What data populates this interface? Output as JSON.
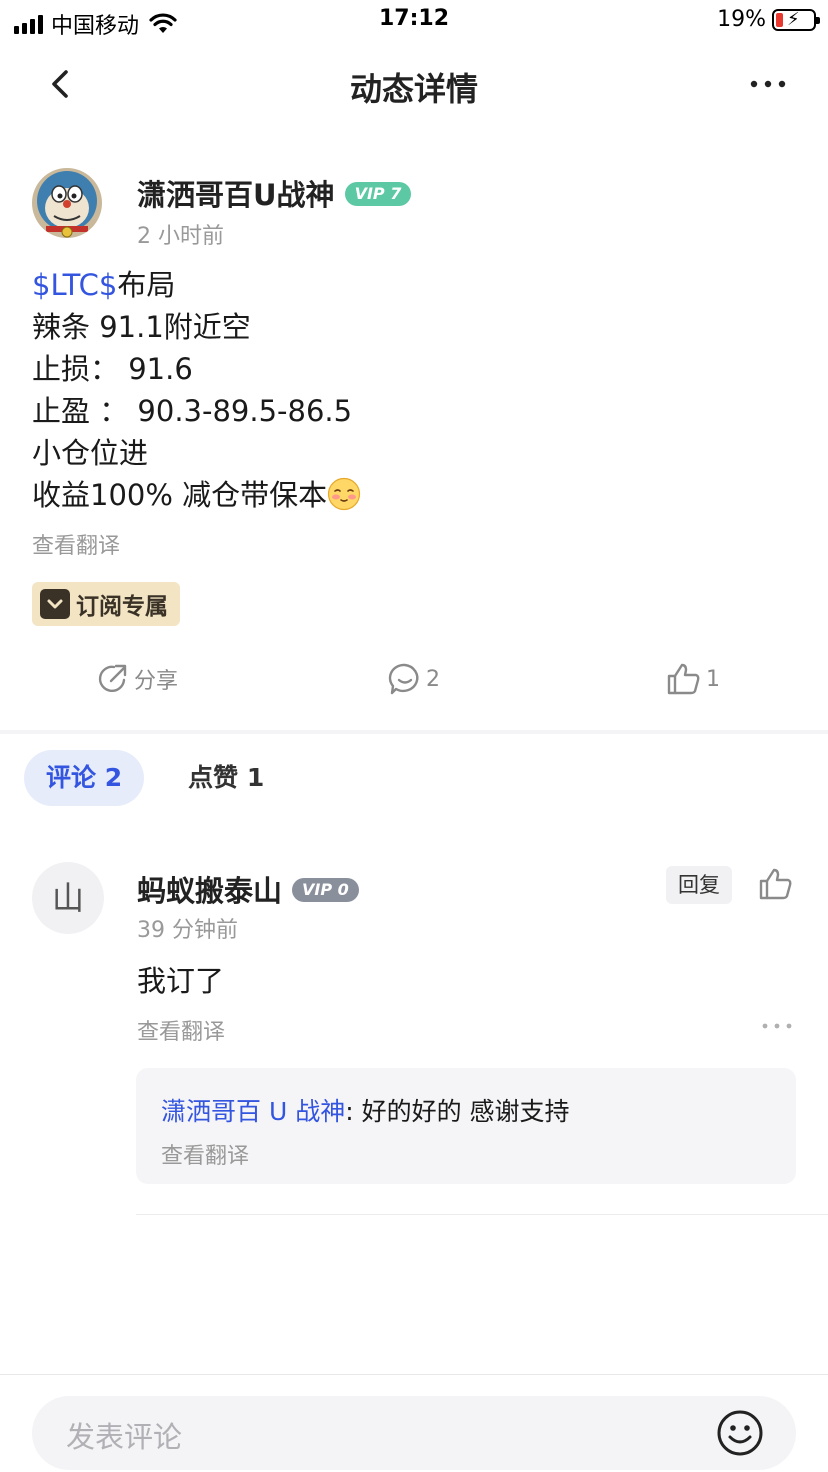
{
  "status_bar": {
    "carrier": "中国移动",
    "time": "17:12",
    "battery": "19%"
  },
  "nav": {
    "title": "动态详情",
    "back_icon": "chevron-left-icon",
    "more_icon": "more-dots-icon"
  },
  "post": {
    "author": "潇洒哥百U战神",
    "vip": "VIP 7",
    "time": "2 小时前",
    "tag": "$LTC$",
    "lines": [
      "布局",
      "辣条 91.1附近空",
      "止损： 91.6",
      "止盈 ： 90.3-89.5-86.5",
      "小仓位进",
      "收益100% 减仓带保本"
    ],
    "translate": "查看翻译",
    "subscription_badge": "订阅专属",
    "actions": {
      "share": "分享",
      "comments": "2",
      "likes": "1"
    }
  },
  "tabs": [
    {
      "label": "评论 2"
    },
    {
      "label": "点赞 1"
    }
  ],
  "comments": [
    {
      "avatar_initial": "山",
      "name": "蚂蚁搬泰山",
      "vip": "VIP 0",
      "time": "39 分钟前",
      "reply_button": "回复",
      "text": "我订了",
      "translate": "查看翻译",
      "reply": {
        "author": "潇洒哥百 U 战神",
        "text": ": 好的好的 感谢支持",
        "translate": "查看翻译"
      }
    }
  ],
  "input": {
    "placeholder": "发表评论"
  },
  "colors": {
    "accent": "#3355e0",
    "vip7": "#5cc8a4",
    "vip0": "#8a8f9c",
    "subscription_bg": "#f3e4c4"
  }
}
